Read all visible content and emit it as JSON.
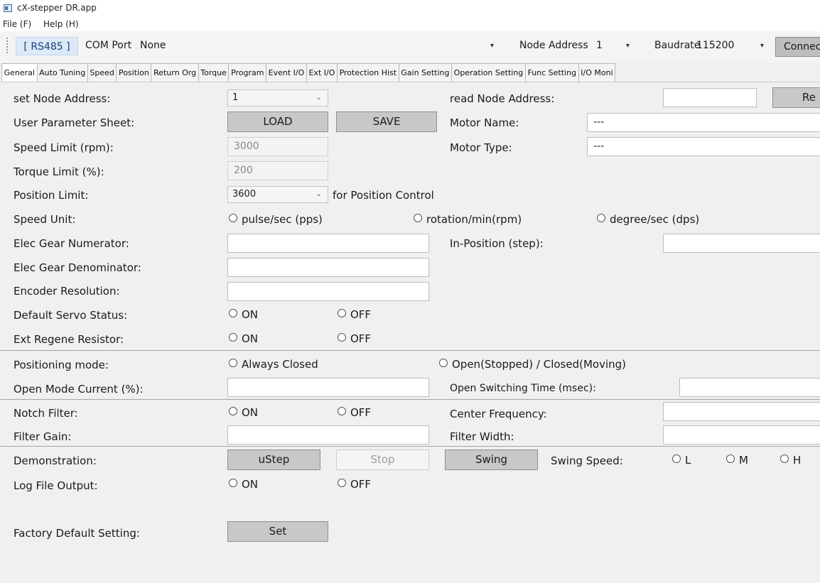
{
  "window": {
    "title": "cX-stepper DR.app"
  },
  "menu": {
    "file": "File (F)",
    "help": "Help (H)"
  },
  "toolbar": {
    "protocol": "[ RS485 ]",
    "com_port_label": "COM Port",
    "com_port_value": "None",
    "node_address_label": "Node Address",
    "node_address_value": "1",
    "baudrate_label": "Baudrate",
    "baudrate_value": "115200",
    "connect_label": "Connec"
  },
  "tabs": [
    {
      "label": "General",
      "active": true
    },
    {
      "label": "Auto Tuning"
    },
    {
      "label": "Speed"
    },
    {
      "label": "Position"
    },
    {
      "label": "Return Org"
    },
    {
      "label": "Torque"
    },
    {
      "label": "Program"
    },
    {
      "label": "Event I/O"
    },
    {
      "label": "Ext I/O"
    },
    {
      "label": "Protection Hist"
    },
    {
      "label": "Gain Setting"
    },
    {
      "label": "Operation Setting"
    },
    {
      "label": "Func Setting"
    },
    {
      "label": "I/O Moni"
    }
  ],
  "general": {
    "set_node_address_label": "set Node Address:",
    "set_node_address_value": "1",
    "read_node_address_label": "read Node Address:",
    "read_button": "Re",
    "user_param_sheet_label": "User Parameter Sheet:",
    "load_button": "LOAD",
    "save_button": "SAVE",
    "motor_name_label": "Motor Name:",
    "motor_name_value": "---",
    "speed_limit_label": "Speed Limit (rpm):",
    "speed_limit_value": "3000",
    "motor_type_label": "Motor Type:",
    "motor_type_value": "---",
    "torque_limit_label": "Torque Limit (%):",
    "torque_limit_value": "200",
    "position_limit_label": "Position Limit:",
    "position_limit_value": "3600",
    "position_limit_note": "for Position Control",
    "speed_unit_label": "Speed Unit:",
    "speed_unit_pps": "pulse/sec (pps)",
    "speed_unit_rpm": "rotation/min(rpm)",
    "speed_unit_dps": "degree/sec (dps)",
    "elec_gear_num_label": "Elec Gear Numerator:",
    "in_position_label": "In-Position (step):",
    "elec_gear_den_label": "Elec Gear Denominator:",
    "encoder_res_label": "Encoder Resolution:",
    "default_servo_label": "Default Servo Status:",
    "ext_regene_label": "Ext Regene Resistor:",
    "on": "ON",
    "off": "OFF",
    "positioning_mode_label": "Positioning mode:",
    "always_closed": "Always Closed",
    "open_closed": "Open(Stopped) / Closed(Moving)",
    "open_mode_current_label": "Open Mode Current (%):",
    "open_switching_label": "Open Switching Time (msec):",
    "notch_filter_label": "Notch Filter:",
    "center_freq_label": "Center Frequency:",
    "filter_gain_label": "Filter Gain:",
    "filter_width_label": "Filter Width:",
    "demonstration_label": "Demonstration:",
    "ustep_button": "uStep",
    "stop_button": "Stop",
    "swing_button": "Swing",
    "swing_speed_label": "Swing Speed:",
    "swing_l": "L",
    "swing_m": "M",
    "swing_h": "H",
    "log_file_label": "Log File Output:",
    "factory_default_label": "Factory Default Setting:",
    "set_button": "Set"
  }
}
